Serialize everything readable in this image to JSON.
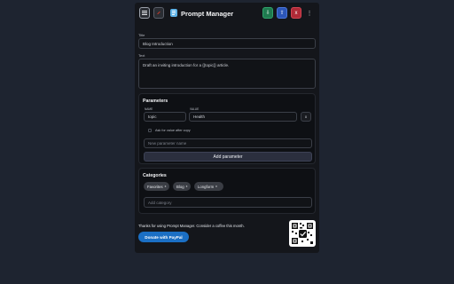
{
  "header": {
    "title": "Prompt Manager",
    "export_label": "⇩",
    "import_label": "⇧",
    "close_label": "x",
    "more_label": "⋮"
  },
  "form": {
    "title_label": "Title",
    "title_value": "Blog Introduction",
    "text_label": "Text",
    "text_value": "Draft an inviting introduction for a {{topic}} article."
  },
  "parameters": {
    "section_title": "Parameters",
    "name_label": "NAME",
    "value_label": "VALUE",
    "name_value": "topic",
    "value_value": "Health",
    "delete_label": "x",
    "ask_label": "Ask for value after copy",
    "new_placeholder": "New parameter name",
    "add_button": "Add parameter"
  },
  "categories": {
    "section_title": "Categories",
    "chips": [
      "Favorites",
      "Blog",
      "Longform"
    ],
    "chip_remove": "x",
    "add_placeholder": "Add category"
  },
  "footer": {
    "thanks_text": "Thanks for using Prompt Manager. Consider a coffee this month.",
    "paypal_button": "Donate with PayPal"
  },
  "colors": {
    "background": "#1e2430",
    "panel": "#14161b",
    "accent_green": "#1f7a4f",
    "accent_blue": "#2c56b8",
    "accent_red": "#b02a37",
    "paypal_blue": "#1b6fc4"
  }
}
